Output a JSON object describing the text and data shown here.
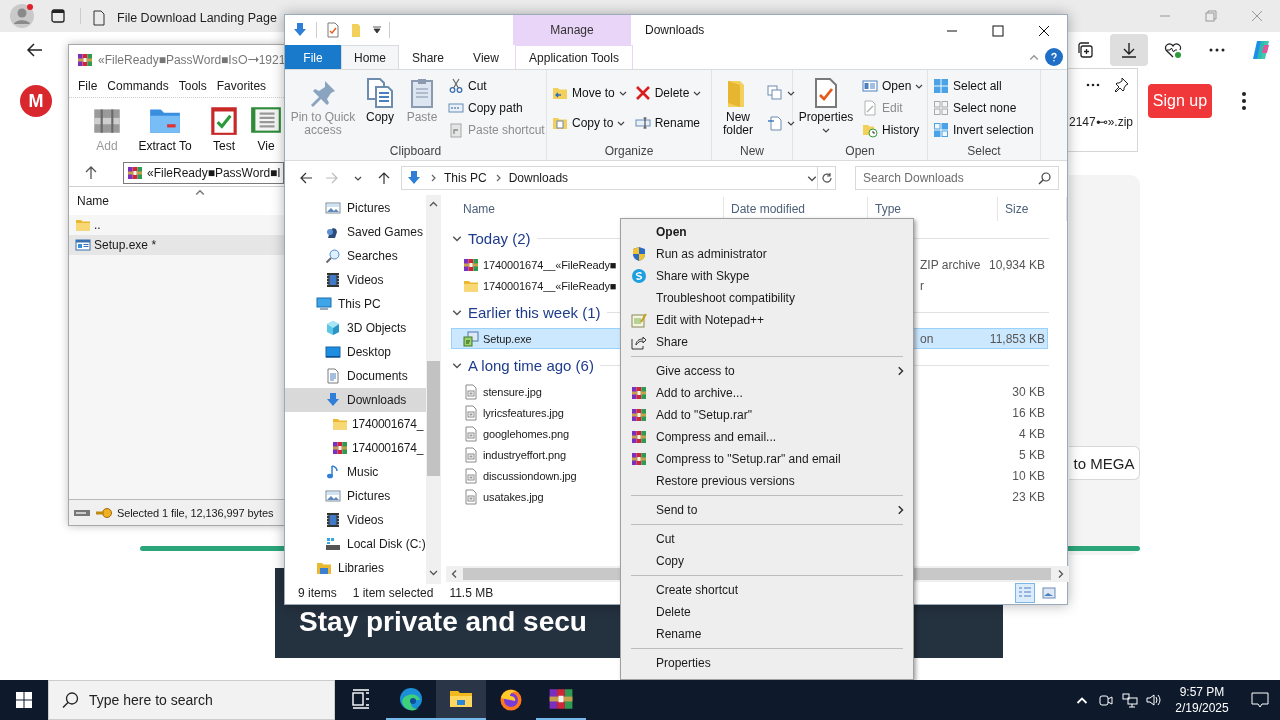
{
  "browser": {
    "tabs": [
      {
        "title": "File Download Landing Page",
        "selected": false
      }
    ],
    "page": {
      "logo": "M",
      "download_file": "2147⊷».zip",
      "sign_up": "Sign up",
      "mega_button": "to MEGA",
      "banner": "Stay private and secu"
    }
  },
  "winrar": {
    "title": "«FileReady■PassWord■Is⭘➝1921",
    "menu": [
      "File",
      "Commands",
      "Tools",
      "Favorites"
    ],
    "toolbar": [
      {
        "label": "Add",
        "kind": "add",
        "disabled": true
      },
      {
        "label": "Extract To",
        "kind": "extract",
        "disabled": false
      },
      {
        "label": "Test",
        "kind": "test",
        "disabled": false
      },
      {
        "label": "Vie",
        "kind": "view",
        "disabled": false
      }
    ],
    "path": "«FileReady■PassWord■I",
    "column": "Name",
    "rows": [
      {
        "name": "..",
        "kind": "folder",
        "selected": false
      },
      {
        "name": "Setup.exe *",
        "kind": "exe",
        "selected": true
      }
    ],
    "status": "Selected 1 file, 12,136,997 bytes"
  },
  "explorer": {
    "title": "Downloads",
    "context_tab": "Manage",
    "tabs": [
      {
        "label": "File",
        "kind": "file",
        "selected": false
      },
      {
        "label": "Home",
        "kind": "tab",
        "selected": true
      },
      {
        "label": "Share",
        "kind": "tab",
        "selected": false
      },
      {
        "label": "View",
        "kind": "tab",
        "selected": false
      },
      {
        "label": "Application Tools",
        "kind": "context",
        "selected": false
      }
    ],
    "ribbon": [
      {
        "label": "Clipboard",
        "large": [
          {
            "label": "Pin to Quick access",
            "kind": "pin",
            "disabled": true,
            "dropdown": false
          },
          {
            "label": "Copy",
            "kind": "copy",
            "disabled": false,
            "dropdown": false
          },
          {
            "label": "Paste",
            "kind": "paste",
            "disabled": true,
            "dropdown": false
          }
        ],
        "small": [
          [
            {
              "label": "Cut",
              "kind": "cut",
              "disabled": false,
              "dropdown": false
            },
            {
              "label": "Copy path",
              "kind": "copypath",
              "disabled": false,
              "dropdown": false
            },
            {
              "label": "Paste shortcut",
              "kind": "pasteshortcut",
              "disabled": true,
              "dropdown": false
            }
          ]
        ]
      },
      {
        "label": "Organize",
        "small": [
          [
            {
              "label": "Move to",
              "kind": "moveto",
              "disabled": false,
              "dropdown": true
            },
            {
              "label": "Copy to",
              "kind": "copyto",
              "disabled": false,
              "dropdown": true
            }
          ],
          [
            {
              "label": "Delete",
              "kind": "delete",
              "disabled": false,
              "dropdown": true
            },
            {
              "label": "Rename",
              "kind": "rename",
              "disabled": false,
              "dropdown": false
            }
          ]
        ]
      },
      {
        "label": "New",
        "large": [
          {
            "label": "New folder",
            "kind": "newfolder",
            "disabled": false,
            "dropdown": false
          }
        ],
        "small": [
          [
            {
              "kind": "newitem",
              "disabled": false,
              "dropdown": true
            },
            {
              "kind": "easyaccess",
              "disabled": false,
              "dropdown": true
            }
          ]
        ]
      },
      {
        "label": "Open",
        "large": [
          {
            "label": "Properties",
            "kind": "properties",
            "disabled": false,
            "dropdown": true
          }
        ],
        "small": [
          [
            {
              "label": "Open",
              "kind": "open",
              "disabled": false,
              "dropdown": true
            },
            {
              "label": "Edit",
              "kind": "edit",
              "disabled": true,
              "dropdown": false
            },
            {
              "label": "History",
              "kind": "history",
              "disabled": false,
              "dropdown": false
            }
          ]
        ]
      },
      {
        "label": "Select",
        "small": [
          [
            {
              "label": "Select all",
              "kind": "selectall",
              "disabled": false,
              "dropdown": false
            },
            {
              "label": "Select none",
              "kind": "selectnone",
              "disabled": false,
              "dropdown": false
            },
            {
              "label": "Invert selection",
              "kind": "invert",
              "disabled": false,
              "dropdown": false
            }
          ]
        ]
      }
    ],
    "crumbs": [
      "This PC",
      "Downloads"
    ],
    "search_placeholder": "Search Downloads",
    "nav": {
      "scrolled_items": [
        {
          "label": "Pictures",
          "kind": "pictures",
          "selected": false
        },
        {
          "label": "Saved Games",
          "kind": "games",
          "selected": false
        },
        {
          "label": "Searches",
          "kind": "search",
          "selected": false
        },
        {
          "label": "Videos",
          "kind": "videos",
          "selected": false
        }
      ],
      "tree": [
        {
          "label": "This PC",
          "kind": "pc",
          "selected": false,
          "children": [
            {
              "label": "3D Objects",
              "kind": "objects",
              "selected": false
            },
            {
              "label": "Desktop",
              "kind": "desktop",
              "selected": false
            },
            {
              "label": "Documents",
              "kind": "documents",
              "selected": false
            },
            {
              "label": "Downloads",
              "kind": "downloads",
              "selected": true,
              "children": [
                {
                  "label": "1740001674_",
                  "kind": "folder",
                  "selected": false
                },
                {
                  "label": "1740001674_",
                  "kind": "archive",
                  "selected": false
                }
              ]
            },
            {
              "label": "Music",
              "kind": "music",
              "selected": false
            },
            {
              "label": "Pictures",
              "kind": "pictures",
              "selected": false
            },
            {
              "label": "Videos",
              "kind": "videos",
              "selected": false
            },
            {
              "label": "Local Disk (C:)",
              "kind": "disk",
              "selected": false
            }
          ]
        },
        {
          "label": "Libraries",
          "kind": "libraries",
          "selected": false
        }
      ]
    },
    "columns": [
      "Name",
      "Date modified",
      "Type",
      "Size"
    ],
    "groups": [
      {
        "title": "Today (2)",
        "expanded": true,
        "files": [
          {
            "name": "1740001674__«FileReady■",
            "kind": "archive",
            "type": "ZIP archive",
            "size": "10,934 KB",
            "selected": false
          },
          {
            "name": "1740001674__«FileReady■",
            "kind": "folder",
            "type": "r",
            "selected": false
          }
        ]
      },
      {
        "title": "Earlier this week (1)",
        "expanded": true,
        "files": [
          {
            "name": "Setup.exe",
            "kind": "exe",
            "type": "on",
            "size": "11,853 KB",
            "selected": true
          }
        ]
      },
      {
        "title": "A long time ago (6)",
        "expanded": true,
        "files": [
          {
            "name": "stensure.jpg",
            "kind": "image",
            "size": "30 KB",
            "selected": false
          },
          {
            "name": "lyricsfeatures.jpg",
            "kind": "image",
            "size": "16 KB",
            "selected": false
          },
          {
            "name": "googlehomes.png",
            "kind": "image",
            "size": "4 KB",
            "selected": false
          },
          {
            "name": "industryeffort.png",
            "kind": "image",
            "size": "5 KB",
            "selected": false
          },
          {
            "name": "discussiondown.jpg",
            "kind": "image",
            "size": "10 KB",
            "selected": false
          },
          {
            "name": "usatakes.jpg",
            "kind": "image",
            "size": "23 KB",
            "selected": false
          }
        ]
      }
    ],
    "status": {
      "count": "9 items",
      "selection": "1 item selected",
      "size": "11.5 MB"
    }
  },
  "context_menu": [
    {
      "label": "Open",
      "kind": "plain",
      "default": true
    },
    {
      "label": "Run as administrator",
      "kind": "shield",
      "default": false
    },
    {
      "label": "Share with Skype",
      "kind": "skype",
      "default": false
    },
    {
      "label": "Troubleshoot compatibility",
      "kind": "plain",
      "default": false
    },
    {
      "label": "Edit with Notepad++",
      "kind": "notepad",
      "default": false
    },
    {
      "label": "Share",
      "kind": "share",
      "default": false
    },
    {
      "kind": "separator"
    },
    {
      "label": "Give access to",
      "kind": "submenu",
      "default": false
    },
    {
      "label": "Add to archive...",
      "kind": "archiver",
      "default": false
    },
    {
      "label": "Add to \"Setup.rar\"",
      "kind": "archiver",
      "default": false
    },
    {
      "label": "Compress and email...",
      "kind": "archiver",
      "default": false
    },
    {
      "label": "Compress to \"Setup.rar\" and email",
      "kind": "archiver",
      "default": false
    },
    {
      "label": "Restore previous versions",
      "kind": "plain",
      "default": false
    },
    {
      "kind": "separator"
    },
    {
      "label": "Send to",
      "kind": "submenu",
      "default": false
    },
    {
      "kind": "separator"
    },
    {
      "label": "Cut",
      "kind": "plain",
      "default": false
    },
    {
      "label": "Copy",
      "kind": "plain",
      "default": false
    },
    {
      "kind": "separator"
    },
    {
      "label": "Create shortcut",
      "kind": "plain",
      "default": false
    },
    {
      "label": "Delete",
      "kind": "plain",
      "default": false
    },
    {
      "label": "Rename",
      "kind": "plain",
      "default": false
    },
    {
      "kind": "separator"
    },
    {
      "label": "Properties",
      "kind": "plain",
      "default": false
    }
  ],
  "taskbar": {
    "search_placeholder": "Type here to search",
    "apps": [
      {
        "kind": "taskview",
        "active": false,
        "running": false
      },
      {
        "kind": "edge",
        "active": false,
        "running": true
      },
      {
        "kind": "explorer",
        "active": true,
        "running": true
      },
      {
        "kind": "firefox",
        "active": false,
        "running": false
      },
      {
        "kind": "winrar",
        "active": false,
        "running": true
      }
    ],
    "time": "9:57 PM",
    "date": "2/19/2025"
  }
}
